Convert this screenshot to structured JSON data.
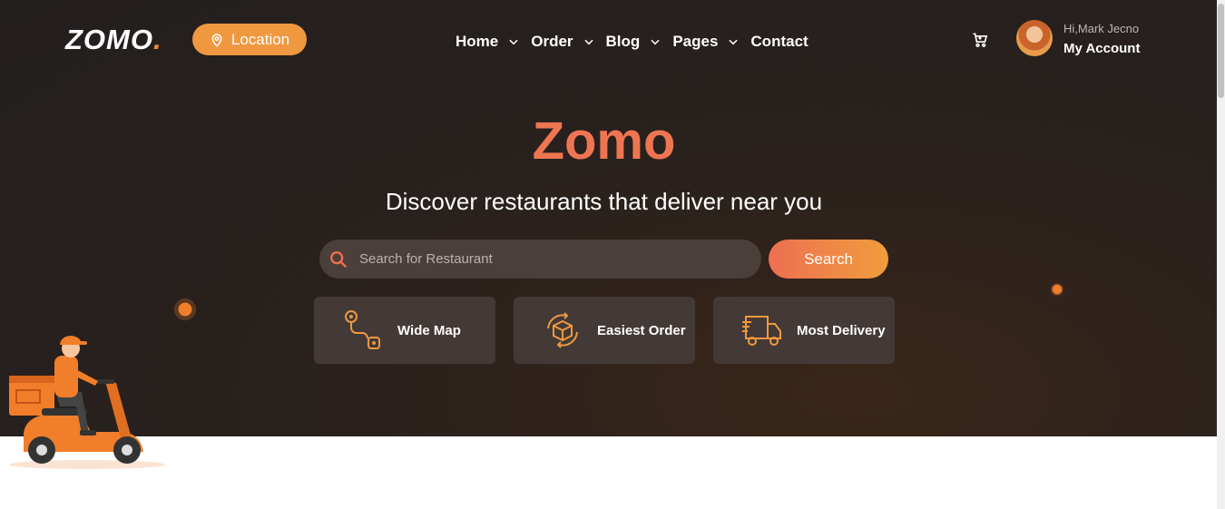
{
  "header": {
    "logo_text": "ZOMO",
    "logo_dot": ".",
    "location_label": "Location",
    "nav": [
      {
        "label": "Home",
        "has_dropdown": true
      },
      {
        "label": "Order",
        "has_dropdown": true
      },
      {
        "label": "Blog",
        "has_dropdown": true
      },
      {
        "label": "Pages",
        "has_dropdown": true
      },
      {
        "label": "Contact",
        "has_dropdown": false
      }
    ],
    "greeting": "Hi,Mark Jecno",
    "account_label": "My Account"
  },
  "hero": {
    "title": "Zomo",
    "subtitle": "Discover restaurants that deliver near you",
    "search": {
      "placeholder": "Search for Restaurant",
      "value": "",
      "button_label": "Search"
    },
    "features": [
      {
        "label": "Wide Map",
        "icon": "route-map-icon"
      },
      {
        "label": "Easiest Order",
        "icon": "box-refresh-icon"
      },
      {
        "label": "Most Delivery",
        "icon": "delivery-truck-icon"
      }
    ]
  },
  "colors": {
    "accent": "#f0983f",
    "title": "#ee7552",
    "hero_bg": "#231f1e",
    "card_bg": "#433a37"
  }
}
